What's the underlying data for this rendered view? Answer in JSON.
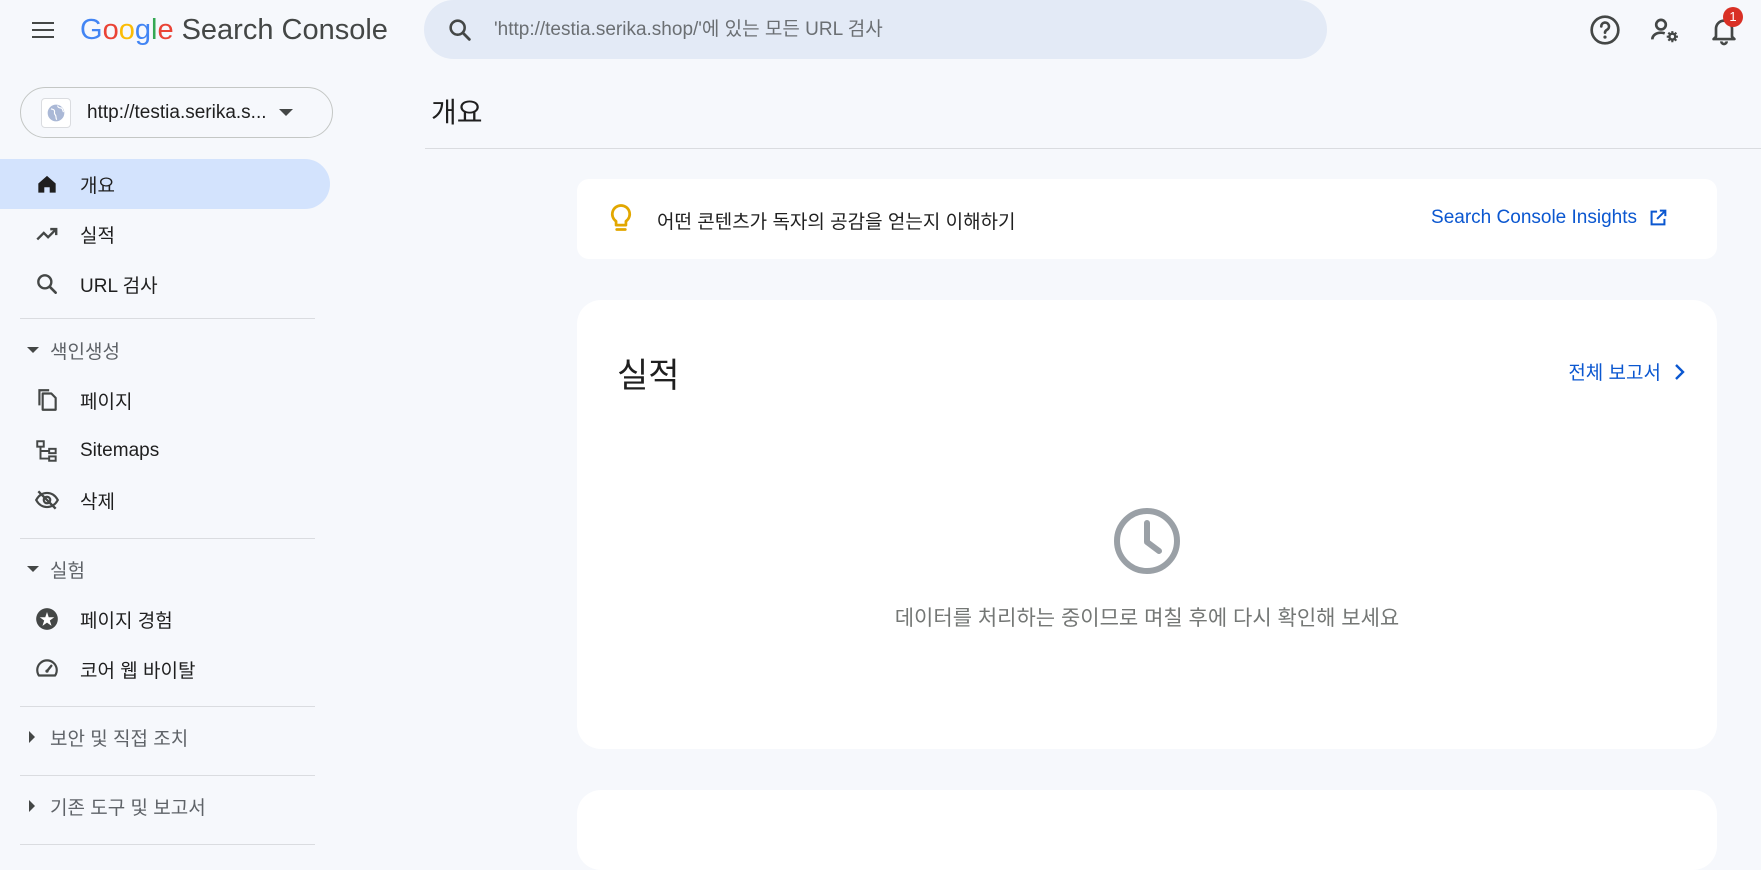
{
  "header": {
    "logo_google": [
      "G",
      "o",
      "o",
      "g",
      "l",
      "e"
    ],
    "product_name": "Search Console",
    "search_placeholder": "'http://testia.serika.shop/'에 있는 모든 URL 검사",
    "notification_count": "1",
    "icons": {
      "menu": "hamburger-menu-icon",
      "search": "search-icon",
      "help": "help-icon",
      "users": "user-settings-icon",
      "notifications": "bell-icon"
    }
  },
  "sidebar": {
    "property_label": "http://testia.serika.s...",
    "items": [
      {
        "label": "개요",
        "icon": "home-icon",
        "active": true
      },
      {
        "label": "실적",
        "icon": "trending-up-icon"
      },
      {
        "label": "URL 검사",
        "icon": "search-icon"
      }
    ],
    "sections": [
      {
        "label": "색인생성",
        "expanded": true,
        "items": [
          {
            "label": "페이지",
            "icon": "pages-icon"
          },
          {
            "label": "Sitemaps",
            "icon": "sitemap-icon"
          },
          {
            "label": "삭제",
            "icon": "eye-off-icon"
          }
        ]
      },
      {
        "label": "실험",
        "expanded": true,
        "items": [
          {
            "label": "페이지 경험",
            "icon": "page-experience-icon"
          },
          {
            "label": "코어 웹 바이탈",
            "icon": "speed-gauge-icon"
          }
        ]
      },
      {
        "label": "보안 및 직접 조치",
        "expanded": false
      },
      {
        "label": "기존 도구 및 보고서",
        "expanded": false
      }
    ]
  },
  "main": {
    "page_title": "개요",
    "insight": {
      "text": "어떤 콘텐츠가 독자의 공감을 얻는지 이해하기",
      "link": "Search Console Insights"
    },
    "performance": {
      "title": "실적",
      "report_link": "전체 보고서",
      "processing_message": "데이터를 처리하는 중이므로 며칠 후에 다시 확인해 보세요"
    }
  },
  "colors": {
    "accent": "#0b57d0",
    "active_nav": "#d3e3fd",
    "background": "#f6f8fc",
    "search_bg": "#e3eaf6",
    "bulb": "#e2a700",
    "badge": "#d93025"
  }
}
